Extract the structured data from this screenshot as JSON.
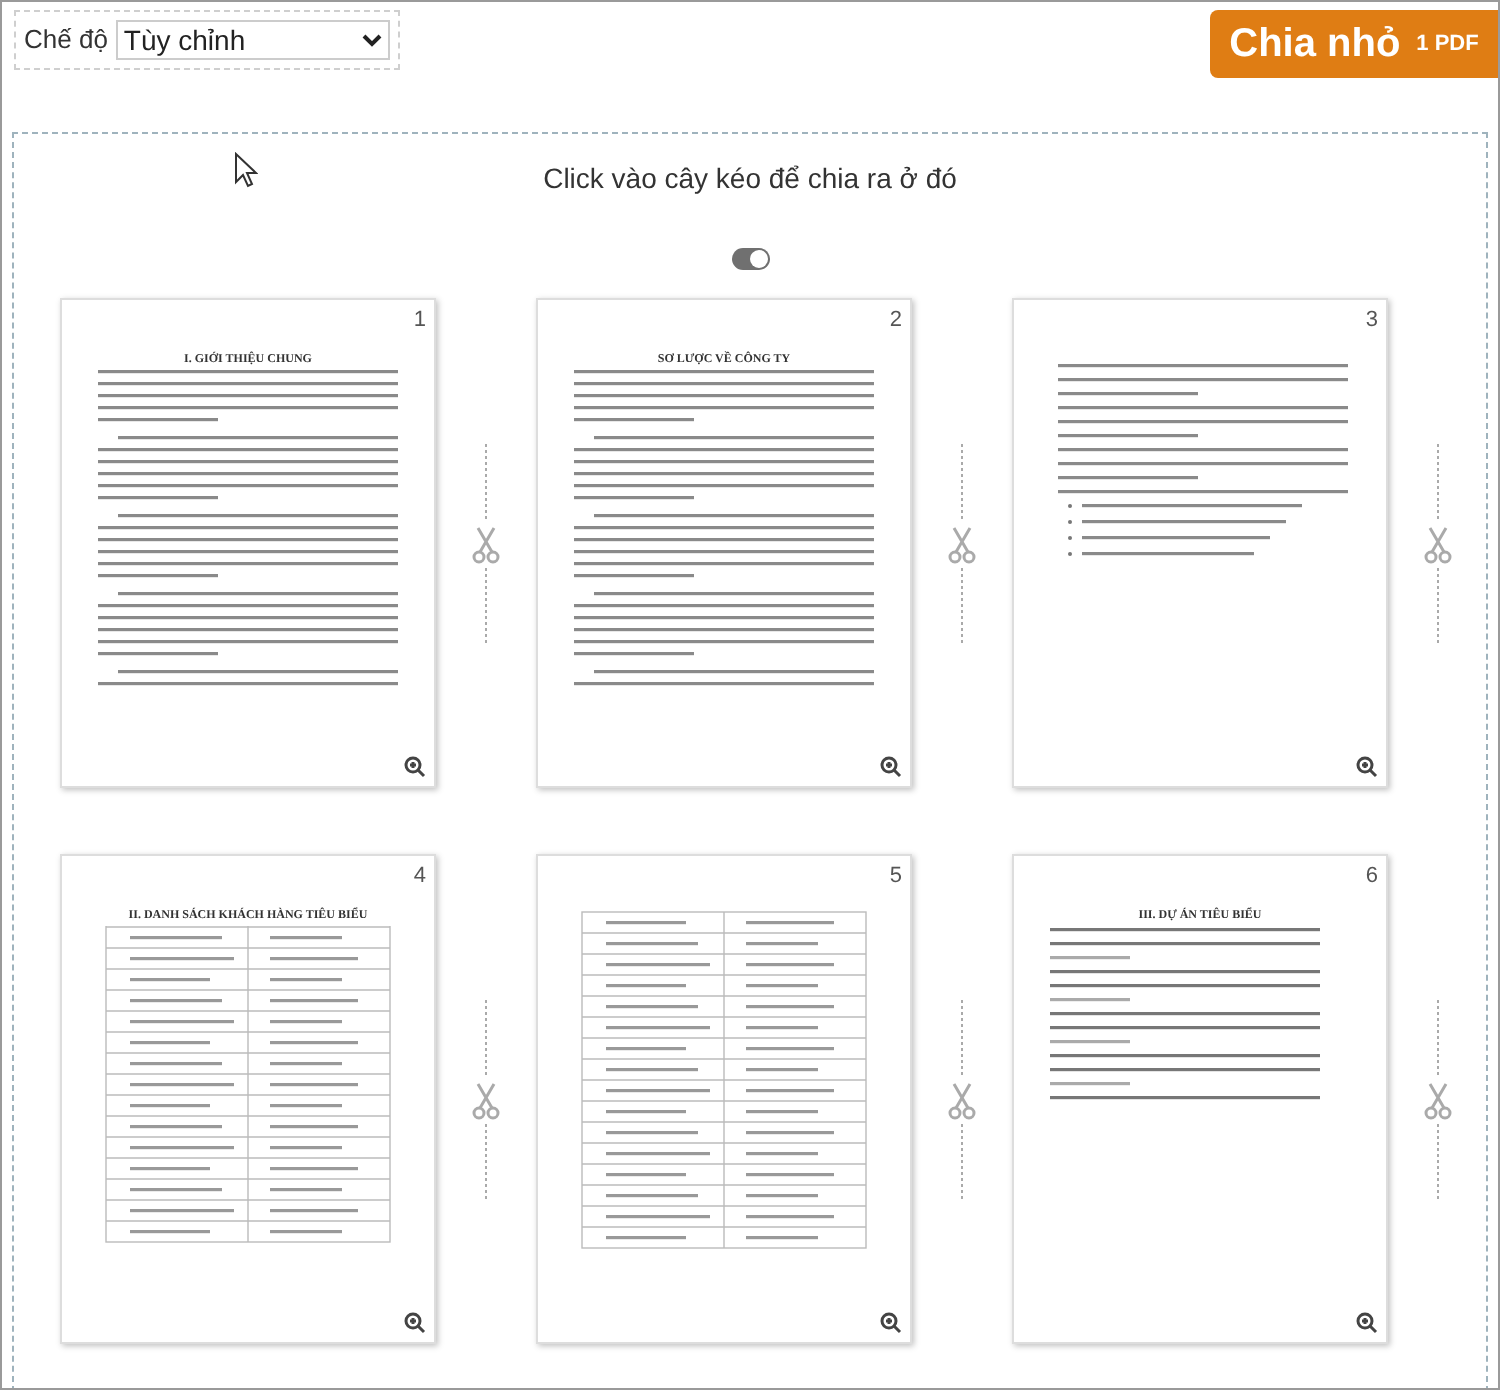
{
  "mode": {
    "label": "Chế độ",
    "value": "Tùy chỉnh"
  },
  "split_button": {
    "label": "Chia nhỏ",
    "badge": "1 PDF"
  },
  "instruction": "Click vào cây kéo để chia ra ở đó",
  "toggle": {
    "on": true
  },
  "pages": [
    {
      "number": "1",
      "heading": "I. GIỚI THIỆU CHUNG",
      "kind": "text"
    },
    {
      "number": "2",
      "heading": "SƠ LƯỢC VỀ CÔNG TY",
      "kind": "text"
    },
    {
      "number": "3",
      "kind": "list"
    },
    {
      "number": "4",
      "heading": "II. DANH SÁCH KHÁCH HÀNG TIÊU BIỂU",
      "kind": "table"
    },
    {
      "number": "5",
      "kind": "table"
    },
    {
      "number": "6",
      "heading": "III. DỰ ÁN TIÊU BIỂU",
      "kind": "links"
    }
  ]
}
